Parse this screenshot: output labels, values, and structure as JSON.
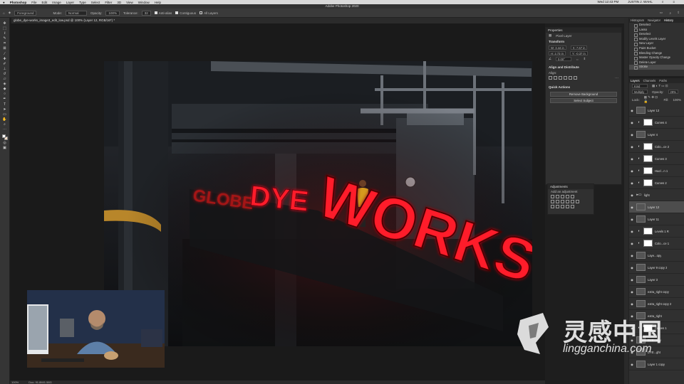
{
  "menubar": {
    "items": [
      "Photoshop",
      "File",
      "Edit",
      "Image",
      "Layer",
      "Type",
      "Select",
      "Filter",
      "3D",
      "View",
      "Window",
      "Help"
    ],
    "clock": "Wed 12:43 PM",
    "user": "JUSTIN J. WAHL"
  },
  "app_title": "Adobe Photoshop 2020",
  "options": {
    "mode_label": "Mode:",
    "mode_value": "Normal",
    "opacity_label": "Opacity:",
    "opacity_value": "100%",
    "tolerance_label": "Tolerance:",
    "tolerance_value": "32",
    "preset": "Foreground",
    "anti_alias": "Anti-alias",
    "contiguous": "Contiguous",
    "all_layers": "All Layers"
  },
  "document_tab": "globe_dye-works_image3_edit_low.psd @ 100% (Layer 12, RGB/16*) *",
  "status": {
    "zoom": "100%",
    "doc": "Doc: 91.8M/1.58G"
  },
  "artwork": {
    "sign_left": "DYE",
    "sign_main": "WORKS",
    "sign_far": "GLOBE"
  },
  "properties": {
    "tab": "Properties",
    "kind": "Pixel Layer",
    "transform_title": "Transform",
    "w": "W: 3.44 in",
    "x": "X: 7.67 in",
    "h": "H: 2.73 in",
    "y": "Y: -0.37 in",
    "angle": "0.00°",
    "align_title": "Align and Distribute",
    "align_label": "Align:",
    "quick_title": "Quick Actions",
    "remove_bg": "Remove Background",
    "select_subject": "Select Subject"
  },
  "adjustments": {
    "title": "Adjustments",
    "subtitle": "Add an adjustment"
  },
  "history": {
    "tabs": [
      "Histogram",
      "Navigator",
      "History"
    ],
    "items": [
      "Deselect",
      "Lasso",
      "Deselect",
      "Modify Levels Layer",
      "New Layer",
      "Paint Bucket",
      "Blending Change",
      "Master Opacity Change",
      "Delete Layer",
      "Stroke"
    ]
  },
  "layers": {
    "tabs": [
      "Layers",
      "Channels",
      "Paths"
    ],
    "kind_filter": "Kind",
    "blend": "Multiply",
    "opacity_label": "Opacity:",
    "opacity": "29%",
    "lock_label": "Lock:",
    "fill_label": "Fill:",
    "fill": "100%",
    "rows": [
      {
        "name": "Layer 13",
        "type": "pixel"
      },
      {
        "name": "Curves 4",
        "type": "adj"
      },
      {
        "name": "Layer 4",
        "type": "pixel"
      },
      {
        "name": "Colo...ce 2",
        "type": "adj"
      },
      {
        "name": "Curves 3",
        "type": "adj"
      },
      {
        "name": "Hue/...n 1",
        "type": "adj"
      },
      {
        "name": "Curves 2",
        "type": "adj"
      },
      {
        "name": "light",
        "type": "group"
      },
      {
        "name": "Layer 12",
        "type": "pixel",
        "selected": true
      },
      {
        "name": "Layer 11",
        "type": "pixel"
      },
      {
        "name": "Levels 1 R",
        "type": "adj"
      },
      {
        "name": "Colo...ce 1",
        "type": "adj"
      },
      {
        "name": "Laye...opy",
        "type": "pixel"
      },
      {
        "name": "Layer 9 copy 3",
        "type": "pixel"
      },
      {
        "name": "Layer 3",
        "type": "pixel"
      },
      {
        "name": "extra_right copy",
        "type": "pixel"
      },
      {
        "name": "extra_right copy 2",
        "type": "pixel"
      },
      {
        "name": "extra_right",
        "type": "pixel"
      },
      {
        "name": "Curves 1",
        "type": "adj"
      },
      {
        "name": "DYE...opy",
        "type": "pixel"
      },
      {
        "name": "DYE...ght",
        "type": "pixel"
      },
      {
        "name": "Layer 1 copy",
        "type": "pixel"
      }
    ]
  },
  "watermark": {
    "cn": "灵感中国",
    "url": "lingganchina.com"
  },
  "colors": {
    "neon_red": "#ff1a2a",
    "accent": "#2d8ceb"
  }
}
